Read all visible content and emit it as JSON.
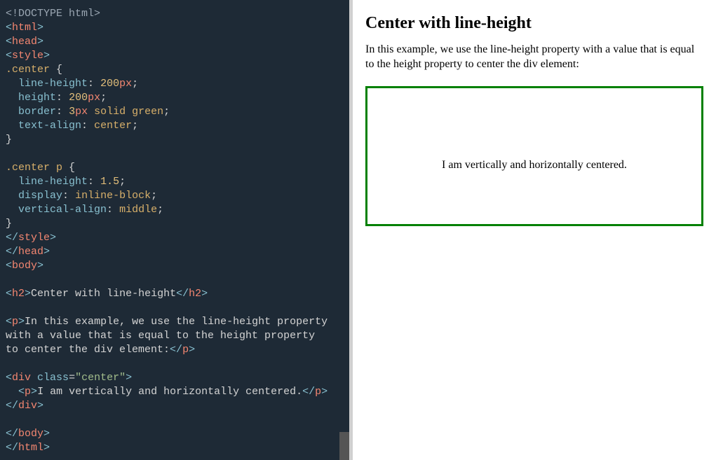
{
  "editor": {
    "doctype": "<!DOCTYPE html>",
    "tags": {
      "html_open": "html",
      "head_open": "head",
      "style_open": "style",
      "style_close": "style",
      "head_close": "head",
      "body_open": "body",
      "h2_open": "h2",
      "h2_close": "h2",
      "p_open": "p",
      "p_close": "p",
      "div_open": "div",
      "div_close": "div",
      "body_close": "body",
      "html_close": "html"
    },
    "css": {
      "sel1": ".center",
      "lh_prop": "line-height",
      "lh_val_num": "200",
      "lh_val_unit": "px",
      "h_prop": "height",
      "h_val_num": "200",
      "h_val_unit": "px",
      "b_prop": "border",
      "b_val_num": "3",
      "b_val_unit": "px",
      "b_val_solid": "solid",
      "b_val_green": "green",
      "ta_prop": "text-align",
      "ta_val": "center",
      "sel2": ".center p",
      "lh2_prop": "line-height",
      "lh2_val": "1.5",
      "disp_prop": "display",
      "disp_val": "inline-block",
      "va_prop": "vertical-align",
      "va_val": "middle"
    },
    "content": {
      "h2_text": "Center with line-height",
      "p1_line1": "In this example, we use the line-height property",
      "p1_line2": "with a value that is equal to the height property",
      "p1_line3": "to center the div element:",
      "attr_class": "class",
      "attr_class_val": "\"center\"",
      "p2_text": "I am vertically and horizontally centered."
    }
  },
  "preview": {
    "heading": "Center with line-height",
    "intro": "In this example, we use the line-height property with a value that is equal to the height property to center the div element:",
    "centered_text": "I am vertically and horizontally centered."
  },
  "colors": {
    "editor_bg": "#1e2a36",
    "border_green": "#008000"
  }
}
